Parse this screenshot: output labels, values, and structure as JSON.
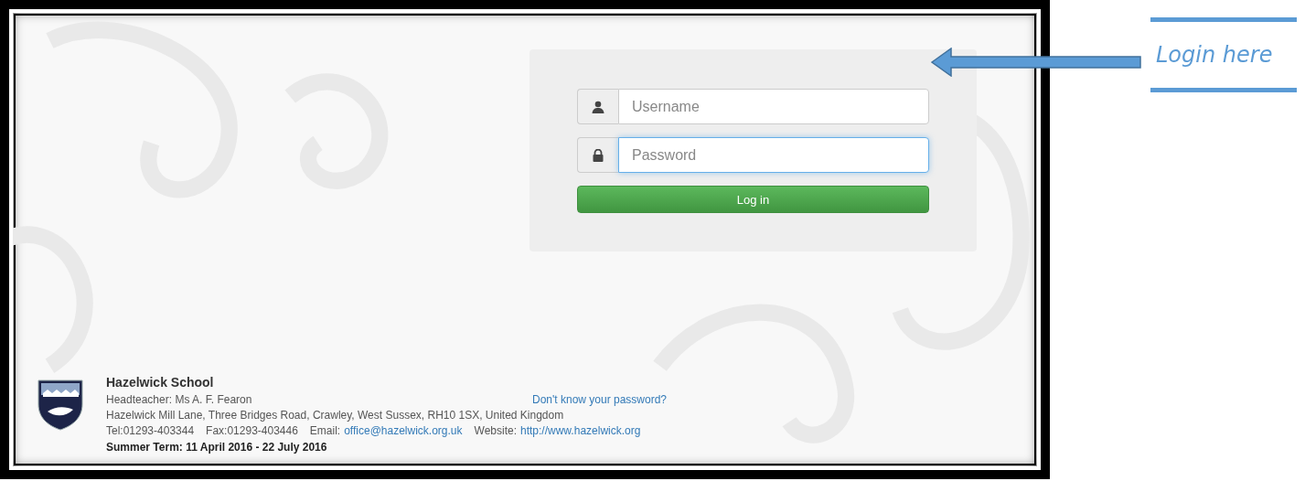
{
  "login_form": {
    "fields": [
      {
        "kind": "username",
        "placeholder": "Username",
        "focused": false
      },
      {
        "kind": "password",
        "placeholder": "Password",
        "focused": true
      }
    ],
    "submit_button": "Log in"
  },
  "forgot_password_link": "Don't know your password?",
  "footer": {
    "school_name": "Hazelwick School",
    "headteacher": "Headteacher: Ms A. F. Fearon",
    "address": "Hazelwick Mill Lane, Three Bridges Road, Crawley, West Sussex, RH10 1SX, United Kingdom",
    "tel": "Tel:01293-403344",
    "fax": "Fax:01293-403446",
    "email_label": "Email:",
    "email": "office@hazelwick.org.uk",
    "website_label": "Website:",
    "website": "http://www.hazelwick.org",
    "term": "Summer Term: 11 April 2016 - 22 July 2016"
  },
  "annotation": {
    "text": "Login here"
  }
}
